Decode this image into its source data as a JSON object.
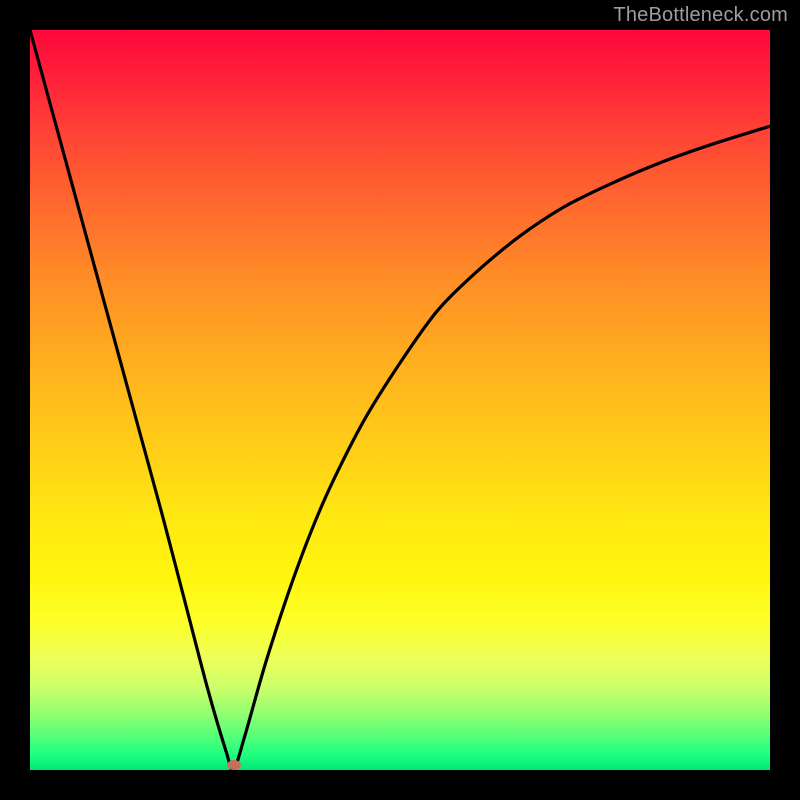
{
  "watermark": "TheBottleneck.com",
  "colors": {
    "frame": "#000000",
    "curve_stroke": "#000000",
    "marker_fill": "#c6705a",
    "watermark_text": "#9d9d9d"
  },
  "chart_data": {
    "type": "line",
    "title": "",
    "xlabel": "",
    "ylabel": "",
    "xlim": [
      0,
      100
    ],
    "ylim": [
      0,
      100
    ],
    "series": [
      {
        "name": "bottleneck-curve",
        "x": [
          0,
          3,
          6,
          9,
          12,
          15,
          18,
          21,
          24,
          26.5,
          27.5,
          29,
          32,
          36,
          40,
          45,
          50,
          55,
          60,
          66,
          72,
          78,
          85,
          92,
          100
        ],
        "values": [
          100,
          89,
          78,
          67,
          56,
          45,
          34,
          22.5,
          11,
          2.5,
          0,
          4.5,
          15,
          27,
          37,
          47,
          55,
          62,
          67,
          72,
          76,
          79,
          82,
          84.5,
          87
        ]
      }
    ],
    "marker": {
      "x": 27.5,
      "y": 0.7
    },
    "gradient_stops": [
      {
        "offset": 0.0,
        "color": "#ff073a"
      },
      {
        "offset": 0.14,
        "color": "#ff4335"
      },
      {
        "offset": 0.34,
        "color": "#ff8e26"
      },
      {
        "offset": 0.58,
        "color": "#ffd216"
      },
      {
        "offset": 0.8,
        "color": "#fcff2a"
      },
      {
        "offset": 0.92,
        "color": "#99ff70"
      },
      {
        "offset": 1.0,
        "color": "#00e676"
      }
    ]
  }
}
